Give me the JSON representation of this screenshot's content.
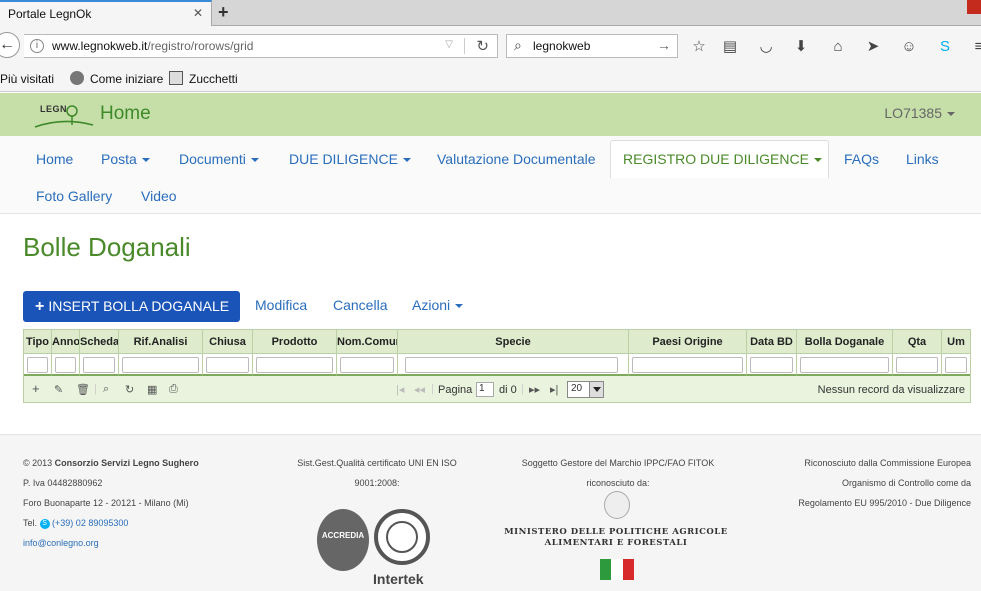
{
  "browser": {
    "tab_title": "Portale LegnOk",
    "tab_close": "✕",
    "new_tab": "+",
    "url_host": "www.legnokweb.it",
    "url_path": "/registro/rorows/grid",
    "search_text": "legnokweb",
    "bookmarks": [
      "Più visitati",
      "Come iniziare",
      "Zucchetti"
    ]
  },
  "header": {
    "logo_text": "LEGN",
    "home_title": "Home",
    "user": "LO71385"
  },
  "nav": {
    "items": [
      {
        "label": "Home"
      },
      {
        "label": "Posta"
      },
      {
        "label": "Documenti"
      },
      {
        "label": "DUE DILIGENCE"
      },
      {
        "label": "Valutazione Documentale"
      },
      {
        "label": "REGISTRO DUE DILIGENCE"
      },
      {
        "label": "FAQs"
      },
      {
        "label": "Links"
      },
      {
        "label": "Foto Gallery"
      },
      {
        "label": "Video"
      }
    ]
  },
  "page": {
    "title": "Bolle Doganali",
    "insert_button": "INSERT BOLLA DOGANALE",
    "edit_label": "Modifica",
    "delete_label": "Cancella",
    "actions_label": "Azioni"
  },
  "grid": {
    "columns": [
      "Tipo",
      "Anno",
      "Scheda",
      "Rif.Analisi",
      "Chiusa",
      "Prodotto",
      "Nom.Comune",
      "Specie",
      "Paesi Origine",
      "Data BD",
      "Bolla Doganale",
      "Qta",
      "Um"
    ],
    "pager": {
      "page_label": "Pagina",
      "page_value": "1",
      "of_label": "di 0",
      "rows_per_page": "20",
      "empty_message": "Nessun record da visualizzare"
    }
  },
  "footer": {
    "col1": {
      "copyright_prefix": "© 2013",
      "company": "Consorzio Servizi Legno Sughero",
      "piva": "P. Iva 04482880962",
      "address": "Foro Buonaparte 12 - 20121 - Milano (Mi)",
      "tel_label": "Tel.",
      "tel": "(+39) 02 89095300",
      "email": "info@conlegno.org"
    },
    "col2": {
      "line1": "Sist.Gest.Qualità certificato UNI EN ISO",
      "line2": "9001:2008:",
      "accredia": "ACCREDIA",
      "intertek": "Intertek"
    },
    "col3": {
      "line1": "Soggetto Gestore del Marchio IPPC/FAO FITOK",
      "line2": "riconosciuto da:",
      "ministry1": "MINISTERO DELLE POLITICHE AGRICOLE",
      "ministry2": "ALIMENTARI E FORESTALI"
    },
    "col4": {
      "line1": "Riconosciuto dalla Commissione Europea",
      "line2": "Organismo di Controllo come da",
      "line3": "Regolamento EU 995/2010 - Due Diligence"
    }
  },
  "colors": {
    "header_bg": "#c6dfa8",
    "brand_green": "#4a8a2a",
    "link_blue": "#2a6ebb",
    "primary_button": "#1b54b8"
  }
}
